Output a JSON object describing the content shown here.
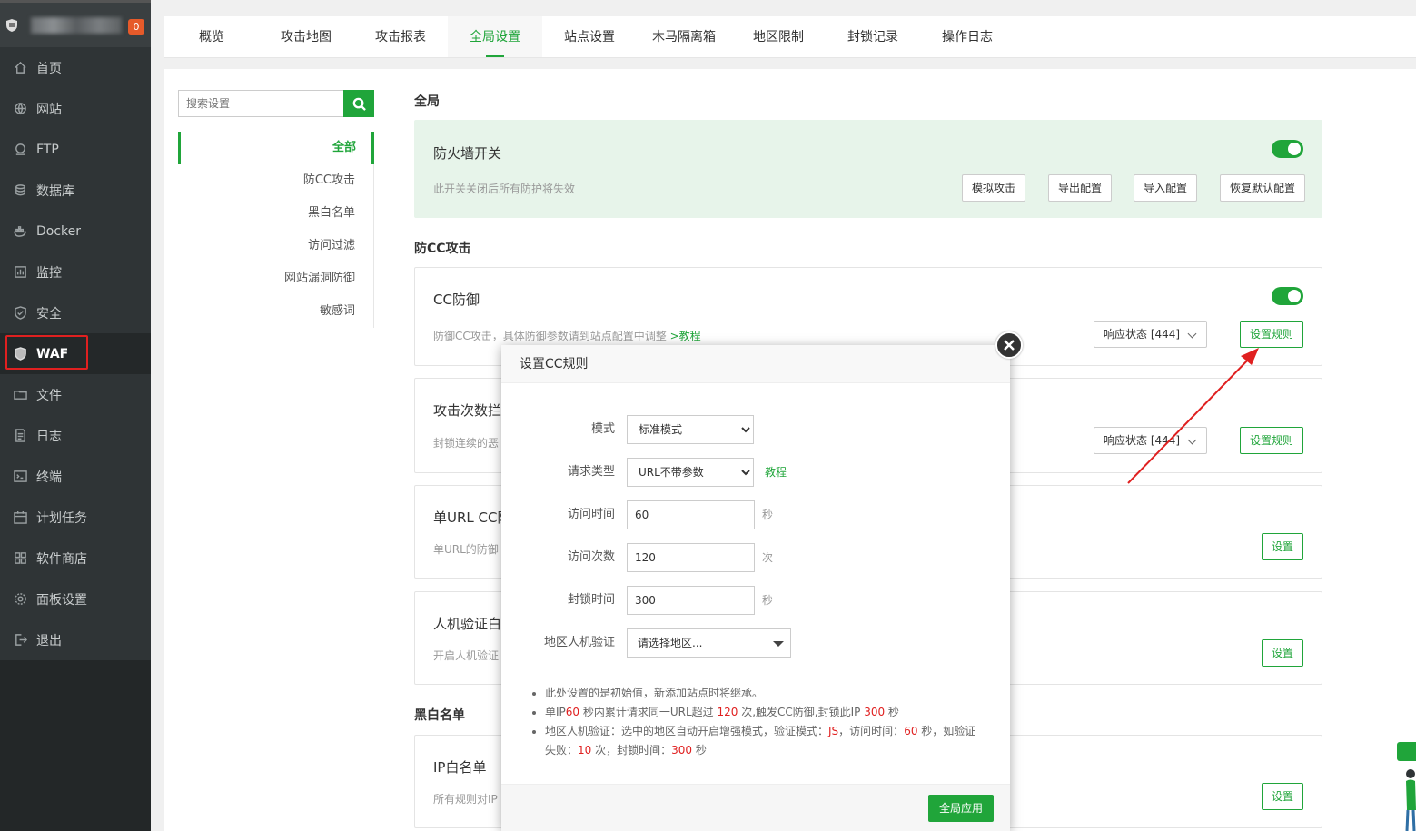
{
  "sidebar": {
    "badge": "0",
    "items": [
      {
        "label": "首页",
        "icon": "home-icon"
      },
      {
        "label": "网站",
        "icon": "globe-icon"
      },
      {
        "label": "FTP",
        "icon": "ftp-icon"
      },
      {
        "label": "数据库",
        "icon": "database-icon"
      },
      {
        "label": "Docker",
        "icon": "docker-icon"
      },
      {
        "label": "监控",
        "icon": "monitor-icon"
      },
      {
        "label": "安全",
        "icon": "shield-check-icon"
      },
      {
        "label": "WAF",
        "icon": "waf-shield-icon"
      },
      {
        "label": "文件",
        "icon": "folder-icon"
      },
      {
        "label": "日志",
        "icon": "log-icon"
      },
      {
        "label": "终端",
        "icon": "terminal-icon"
      },
      {
        "label": "计划任务",
        "icon": "calendar-icon"
      },
      {
        "label": "软件商店",
        "icon": "apps-icon"
      },
      {
        "label": "面板设置",
        "icon": "gear-icon"
      },
      {
        "label": "退出",
        "icon": "logout-icon"
      }
    ],
    "active": "WAF"
  },
  "tabs": [
    "概览",
    "攻击地图",
    "攻击报表",
    "全局设置",
    "站点设置",
    "木马隔离箱",
    "地区限制",
    "封锁记录",
    "操作日志"
  ],
  "active_tab": "全局设置",
  "search": {
    "placeholder": "搜索设置"
  },
  "menu": [
    "全部",
    "防CC攻击",
    "黑白名单",
    "访问过滤",
    "网站漏洞防御",
    "敏感词"
  ],
  "sections": {
    "global": "全局",
    "cc": "防CC攻击",
    "bw": "黑白名单"
  },
  "firewall": {
    "title": "防火墙开关",
    "desc": "此开关关闭后所有防护将失效",
    "buttons": [
      "模拟攻击",
      "导出配置",
      "导入配置",
      "恢复默认配置"
    ]
  },
  "cc_card": {
    "title": "CC防御",
    "desc": "防御CC攻击，具体防御参数请到站点配置中调整 ",
    "link": ">教程",
    "resp": "响应状态 [444]",
    "btn": "设置规则"
  },
  "attack_card": {
    "title": "攻击次数拦",
    "desc": "封锁连续的恶",
    "resp": "响应状态 [444]",
    "btn": "设置规则"
  },
  "url_card": {
    "title": "单URL CC防",
    "desc": "单URL的防御",
    "btn": "设置"
  },
  "human_card": {
    "title": "人机验证白",
    "desc": "开启人机验证",
    "btn": "设置"
  },
  "ip_card": {
    "title": "IP白名单",
    "desc": "所有规则对IP",
    "btn": "设置"
  },
  "modal": {
    "title": "设置CC规则",
    "mode_label": "模式",
    "mode_value": "标准模式",
    "req_label": "请求类型",
    "req_value": "URL不带参数",
    "req_link": "教程",
    "time_label": "访问时间",
    "time_value": "60",
    "time_unit": "秒",
    "count_label": "访问次数",
    "count_value": "120",
    "count_unit": "次",
    "block_label": "封锁时间",
    "block_value": "300",
    "block_unit": "秒",
    "region_label": "地区人机验证",
    "region_placeholder": "请选择地区...",
    "note1": "此处设置的是初始值，新添加站点时将继承。",
    "note2": {
      "a": "单IP",
      "b": "60",
      "c": " 秒内累计请求同一URL超过 ",
      "d": "120",
      "e": " 次,触发CC防御,封锁此IP ",
      "f": "300",
      "g": " 秒"
    },
    "note3": {
      "a": "地区人机验证：选中的地区自动开启增强模式，验证模式：",
      "b": "JS",
      "c": "，访问时间：",
      "d": "60",
      "e": " 秒，如验证失败：",
      "f": "10",
      "g": " 次，封锁时间：",
      "h": "300",
      "i": " 秒"
    },
    "apply": "全局应用"
  },
  "colors": {
    "accent": "#20a53a",
    "sidebar": "#2f3436",
    "highlight": "#e02020"
  }
}
